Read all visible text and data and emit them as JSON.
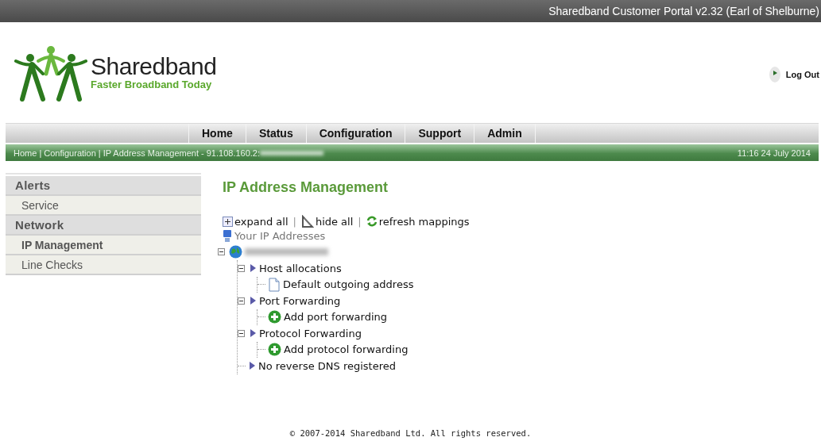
{
  "header": {
    "title": "Sharedband Customer Portal v2.32 (Earl of Shelburne)",
    "logo_name": "Sharedband",
    "logo_tagline": "Faster Broadband Today",
    "logout": "Log Out"
  },
  "nav": {
    "tabs": [
      {
        "label": "Home"
      },
      {
        "label": "Status"
      },
      {
        "label": "Configuration"
      },
      {
        "label": "Support"
      },
      {
        "label": "Admin"
      }
    ]
  },
  "breadcrumb": {
    "path": "Home | Configuration | IP Address Management  - 91.108.160.2:",
    "datetime": "11:16 24 July 2014"
  },
  "sidebar": {
    "items": [
      {
        "kind": "header",
        "label": "Alerts"
      },
      {
        "kind": "item",
        "label": "Service",
        "selected": false
      },
      {
        "kind": "header",
        "label": "Network"
      },
      {
        "kind": "item",
        "label": "IP Management",
        "selected": true
      },
      {
        "kind": "item",
        "label": "Line Checks",
        "selected": false
      }
    ]
  },
  "content": {
    "title": "IP Address Management",
    "actions": [
      {
        "kind": "expand",
        "label": "expand all"
      },
      {
        "kind": "separator",
        "label": "|"
      },
      {
        "kind": "hide",
        "label": "hide all"
      },
      {
        "kind": "separator",
        "label": "|"
      },
      {
        "kind": "refresh",
        "label": "refresh mappings"
      }
    ],
    "tree": {
      "root_label": "Your IP Addresses",
      "nodes": [
        {
          "kind": "redacted",
          "expanded": true,
          "children": [
            {
              "kind": "group",
              "label": "Host allocations",
              "expanded": true,
              "children": [
                {
                  "kind": "page",
                  "label": "Default outgoing address"
                }
              ]
            },
            {
              "kind": "group",
              "label": "Port Forwarding",
              "expanded": true,
              "children": [
                {
                  "kind": "add",
                  "label": "Add port forwarding"
                }
              ]
            },
            {
              "kind": "group",
              "label": "Protocol Forwarding",
              "expanded": true,
              "children": [
                {
                  "kind": "add",
                  "label": "Add protocol forwarding"
                }
              ]
            },
            {
              "kind": "group",
              "label": "No reverse DNS registered"
            }
          ]
        }
      ]
    }
  },
  "footer": {
    "text": "© 2007-2014 Sharedband Ltd. All rights reserved."
  }
}
